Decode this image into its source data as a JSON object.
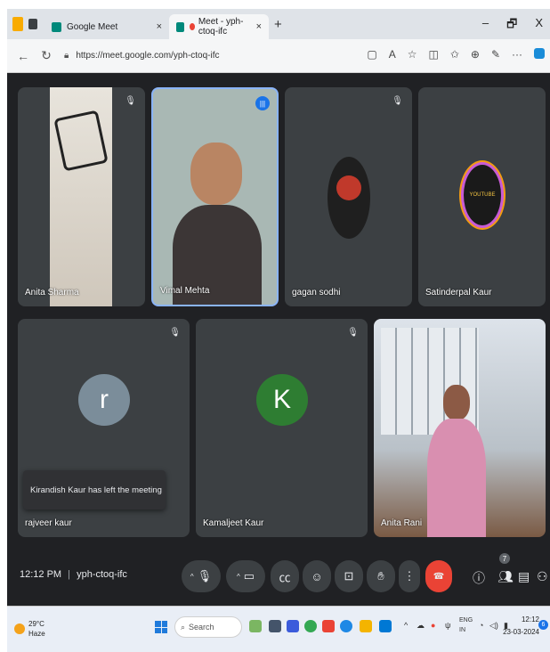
{
  "browser": {
    "tabs": [
      {
        "label": "Google Meet",
        "active": false
      },
      {
        "label": "Meet - yph-ctoq-ifc",
        "active": true
      }
    ],
    "new_tab": "+",
    "controls": {
      "minimize": "–",
      "maximize": "🗗",
      "close": "X"
    },
    "url": "https://meet.google.com/yph-ctoq-ifc"
  },
  "meeting": {
    "tiles": [
      {
        "name": "Anita Sharma",
        "kind": "video"
      },
      {
        "name": "Vimal Mehta",
        "kind": "video",
        "speaking": true
      },
      {
        "name": "gagan sodhi",
        "kind": "photo"
      },
      {
        "name": "Satinderpal Kaur",
        "kind": "logo",
        "logo_text": "YOUTUBE"
      },
      {
        "name": "rajveer kaur",
        "kind": "initial",
        "initial": "r",
        "avatar_color": "#7b8d9a"
      },
      {
        "name": "Kamaljeet Kaur",
        "kind": "initial",
        "initial": "K",
        "avatar_color": "#2e7d32"
      },
      {
        "name": "Anita Rani",
        "kind": "video"
      }
    ],
    "toast": "Kirandish Kaur has left the meeting",
    "time": "12:12 PM",
    "separator": "|",
    "meeting_code": "yph-ctoq-ifc",
    "participant_count": "7"
  },
  "taskbar": {
    "temperature": "29°C",
    "weather": "Haze",
    "search_placeholder": "Search",
    "lang_top": "ENG",
    "lang_bottom": "IN",
    "time": "12:12",
    "date": "23-03-2024",
    "notification_count": "6"
  }
}
